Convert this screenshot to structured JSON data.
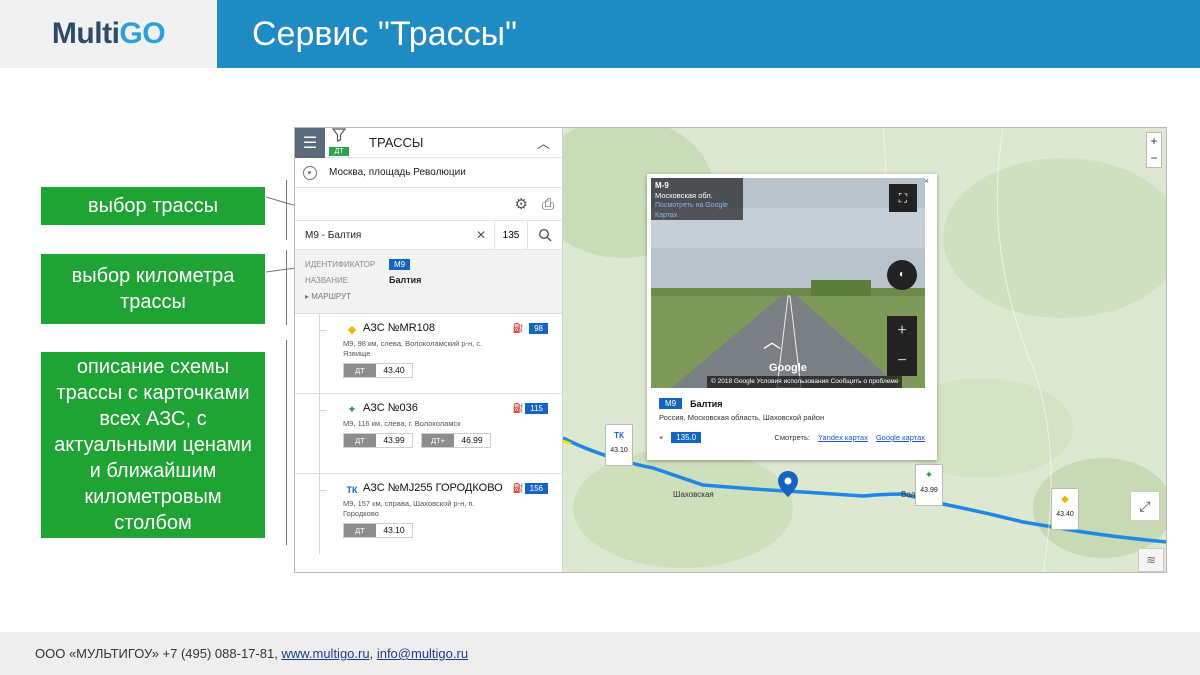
{
  "header": {
    "logo_part1": "Multi",
    "logo_part2": "GO",
    "title": "Сервис \"Трассы\""
  },
  "callouts": {
    "route_select": "выбор трассы",
    "km_select": "выбор километра трассы",
    "scheme_description": "описание схемы трассы с карточками всех АЗС, с актуальными ценами и ближайшим километровым столбом"
  },
  "panel": {
    "filter_badge": "ДТ",
    "title": "ТРАССЫ",
    "location": "Москва, площадь Революции",
    "route_value": "М9 - Балтия",
    "km_value": "135",
    "info": {
      "id_label": "ИДЕНТИФИКАТОР",
      "id_value": "М9",
      "name_label": "НАЗВАНИЕ",
      "name_value": "Балтия",
      "route_label": "МАРШРУТ"
    },
    "stations": [
      {
        "name": "АЗС №MR108",
        "km": "98",
        "address": "М9, 98 км, слева, Волоколамский р-н, с. Язвище",
        "prices": [
          {
            "type": "ДТ",
            "value": "43.40"
          }
        ],
        "logo_color": "#f2b400"
      },
      {
        "name": "АЗС №036",
        "km": "115",
        "address": "М9, 116 км, слева, г. Волоколамск",
        "prices": [
          {
            "type": "ДТ",
            "value": "43.99"
          },
          {
            "type": "ДТ+",
            "value": "46.99"
          }
        ],
        "logo_color": "#1ea334"
      },
      {
        "name": "АЗС №MJ255 ГОРОДКОВО",
        "km": "156",
        "address": "М9, 157 км, справа, Шаховской р-н, п. Городково",
        "prices": [
          {
            "type": "ДТ",
            "value": "43.10"
          }
        ],
        "logo_color": "#1565c0"
      }
    ]
  },
  "map": {
    "popup": {
      "sv_road": "М-9",
      "sv_region": "Московская обл.",
      "sv_link": "Посмотреть на Google Картах",
      "sv_footer": "© 2018 Google   Условия использования   Сообщить о проблеме",
      "sv_google": "Google",
      "badge": "М9",
      "title": "Балтия",
      "address": "Россия, Московская область, Шаховской район",
      "km": "135.0",
      "watch_label": "Смотреть:",
      "link_yandex": "Yandex картах",
      "link_google": "Google картах"
    },
    "markers": [
      {
        "price": "43.10"
      },
      {
        "price": "43.99"
      },
      {
        "price": "43.40"
      }
    ],
    "labels": {
      "town1": "Шаховская",
      "town2": "Воло...мск"
    },
    "route_color": "#1e88e5"
  },
  "footer": {
    "company": "ООО «МУЛЬТИГОУ»  +7 (495) 088-17-81,",
    "site": "www.multigo.ru",
    "sep": ",",
    "email": "info@multigo.ru"
  }
}
